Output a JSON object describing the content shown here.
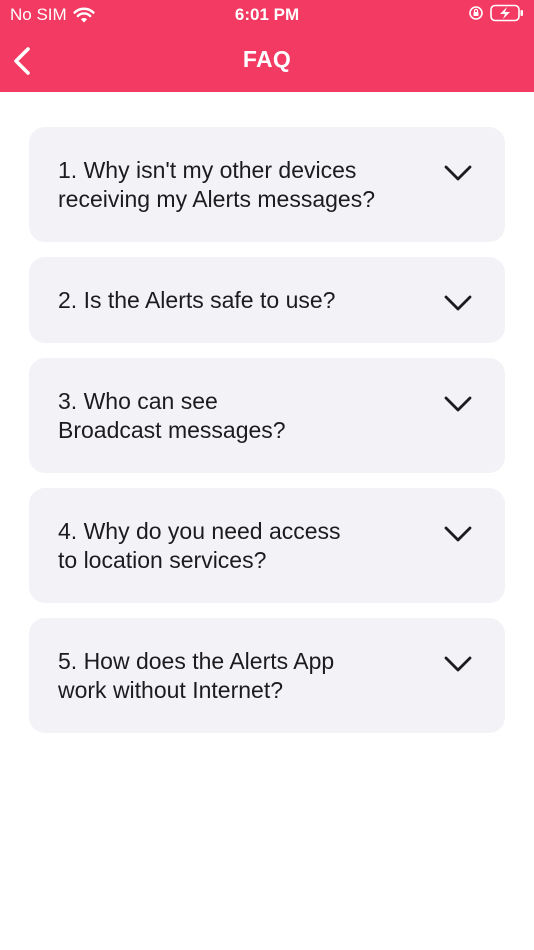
{
  "status_bar": {
    "carrier": "No SIM",
    "time": "6:01 PM"
  },
  "header": {
    "title": "FAQ",
    "background": "#f23a62"
  },
  "faq": {
    "items": [
      {
        "question": "1. Why isn't my other devices\nreceiving my Alerts messages?"
      },
      {
        "question": "2. Is the Alerts safe to use?"
      },
      {
        "question": "3. Who can see\nBroadcast messages?"
      },
      {
        "question": "4. Why do you need access\nto location services?"
      },
      {
        "question": "5. How does the Alerts App\nwork without Internet?"
      }
    ]
  }
}
